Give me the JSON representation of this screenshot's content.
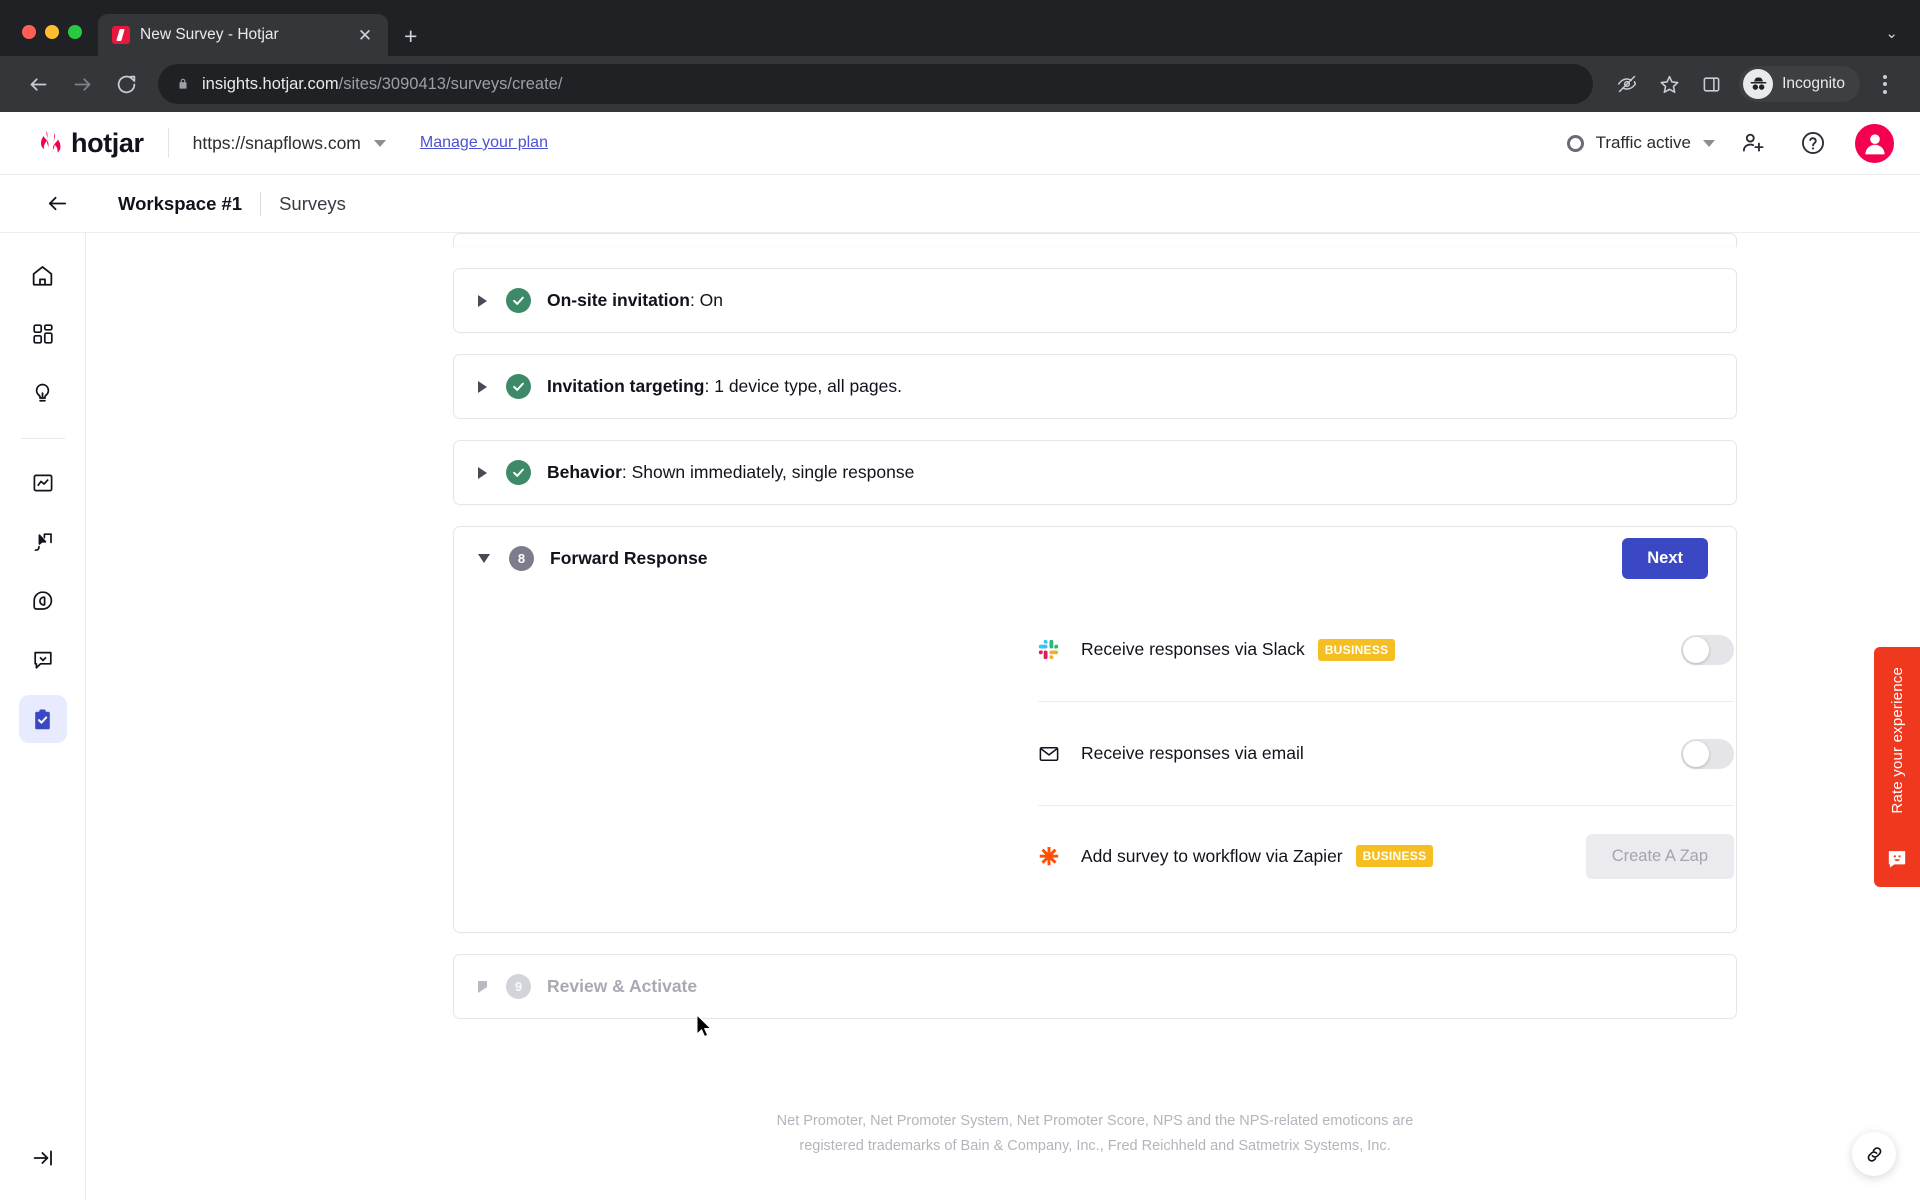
{
  "browser": {
    "tab": {
      "title": "New Survey - Hotjar",
      "favicon": "hotjar-favicon",
      "close_icon": "close-icon"
    },
    "new_tab_icon": "plus-icon",
    "tab_list_icon": "chevron-down-icon",
    "nav": {
      "back_icon": "back-arrow-icon",
      "forward_icon": "forward-arrow-icon",
      "reload_icon": "reload-icon"
    },
    "omnibox": {
      "lock_icon": "lock-icon",
      "url_domain": "insights.hotjar.com",
      "url_path": "/sites/3090413/surveys/create/"
    },
    "toolbar_icons": [
      "eye-off-icon",
      "star-icon",
      "side-panel-icon"
    ],
    "incognito_label": "Incognito",
    "menu_icon": "kebab-menu-icon"
  },
  "header": {
    "logo_text": "hotjar",
    "site_url": "https://snapflows.com",
    "site_caret_icon": "chevron-down-icon",
    "manage_plan": "Manage your plan",
    "traffic_status": "Traffic active",
    "traffic_caret_icon": "chevron-down-icon",
    "invite_icon": "add-user-icon",
    "help_icon": "help-circle-icon",
    "avatar_icon": "user-avatar",
    "accent_red": "#f5004f",
    "accent_blue": "#4b52d4"
  },
  "breadcrumb": {
    "back_icon": "back-arrow-icon",
    "workspace": "Workspace #1",
    "current": "Surveys"
  },
  "sidebar": {
    "items": [
      {
        "name": "home",
        "icon": "home-icon",
        "active": false
      },
      {
        "name": "dashboards",
        "icon": "dashboard-grid-icon",
        "active": false
      },
      {
        "name": "insights",
        "icon": "lightbulb-icon",
        "active": false
      },
      {
        "name": "trends",
        "icon": "chart-trend-icon",
        "active": false
      },
      {
        "name": "recordings",
        "icon": "cursor-flag-icon",
        "active": false
      },
      {
        "name": "highlights",
        "icon": "highlight-pin-icon",
        "active": false
      },
      {
        "name": "feedback",
        "icon": "chat-bubble-icon",
        "active": false
      },
      {
        "name": "surveys",
        "icon": "clipboard-check-icon",
        "active": true
      }
    ],
    "collapse_icon": "expand-sidebar-icon"
  },
  "main": {
    "steps": [
      {
        "id": "on-site-invitation",
        "state": "complete",
        "status_icon": "check-circle-icon",
        "toggle_icon": "triangle-right-icon",
        "title": "On-site invitation",
        "summary": ": On",
        "expanded": false
      },
      {
        "id": "invitation-targeting",
        "state": "complete",
        "status_icon": "check-circle-icon",
        "toggle_icon": "triangle-right-icon",
        "title": "Invitation targeting",
        "summary": ": 1 device type, all pages.",
        "expanded": false
      },
      {
        "id": "behavior",
        "state": "complete",
        "status_icon": "check-circle-icon",
        "toggle_icon": "triangle-right-icon",
        "title": "Behavior",
        "summary": ": Shown immediately, single response",
        "expanded": false
      },
      {
        "id": "forward-response",
        "state": "current",
        "step_number": "8",
        "toggle_icon": "triangle-down-icon",
        "title": "Forward Response",
        "summary": "",
        "expanded": true
      },
      {
        "id": "review-activate",
        "state": "disabled",
        "step_number": "9",
        "toggle_icon": "triangle-right-icon",
        "title": "Review & Activate",
        "summary": "",
        "expanded": false
      }
    ],
    "next_button": "Next",
    "forward_options": [
      {
        "id": "slack",
        "icon": "slack-icon",
        "label": "Receive responses via Slack",
        "badge": "BUSINESS",
        "control": "toggle",
        "toggle_on": false
      },
      {
        "id": "email",
        "icon": "envelope-icon",
        "label": "Receive responses via email",
        "badge": "",
        "control": "toggle",
        "toggle_on": false
      },
      {
        "id": "zapier",
        "icon": "zapier-icon",
        "label": "Add survey to workflow via Zapier",
        "badge": "BUSINESS",
        "control": "button",
        "button_label": "Create A Zap",
        "button_disabled": true
      }
    ],
    "footer_note_line1": "Net Promoter, Net Promoter System, Net Promoter Score, NPS and the NPS-related emoticons are",
    "footer_note_line2": "registered trademarks of Bain & Company, Inc., Fred Reichheld and Satmetrix Systems, Inc.",
    "badge_color": "#f5bf23",
    "next_color": "#3b48c4",
    "check_color": "#3d8a68"
  },
  "widgets": {
    "rate_tab_text": "Rate your experience",
    "rate_tab_icon": "smiley-card-icon",
    "rate_tab_color": "#f0381f",
    "link_fab_icon": "link-chain-icon"
  }
}
